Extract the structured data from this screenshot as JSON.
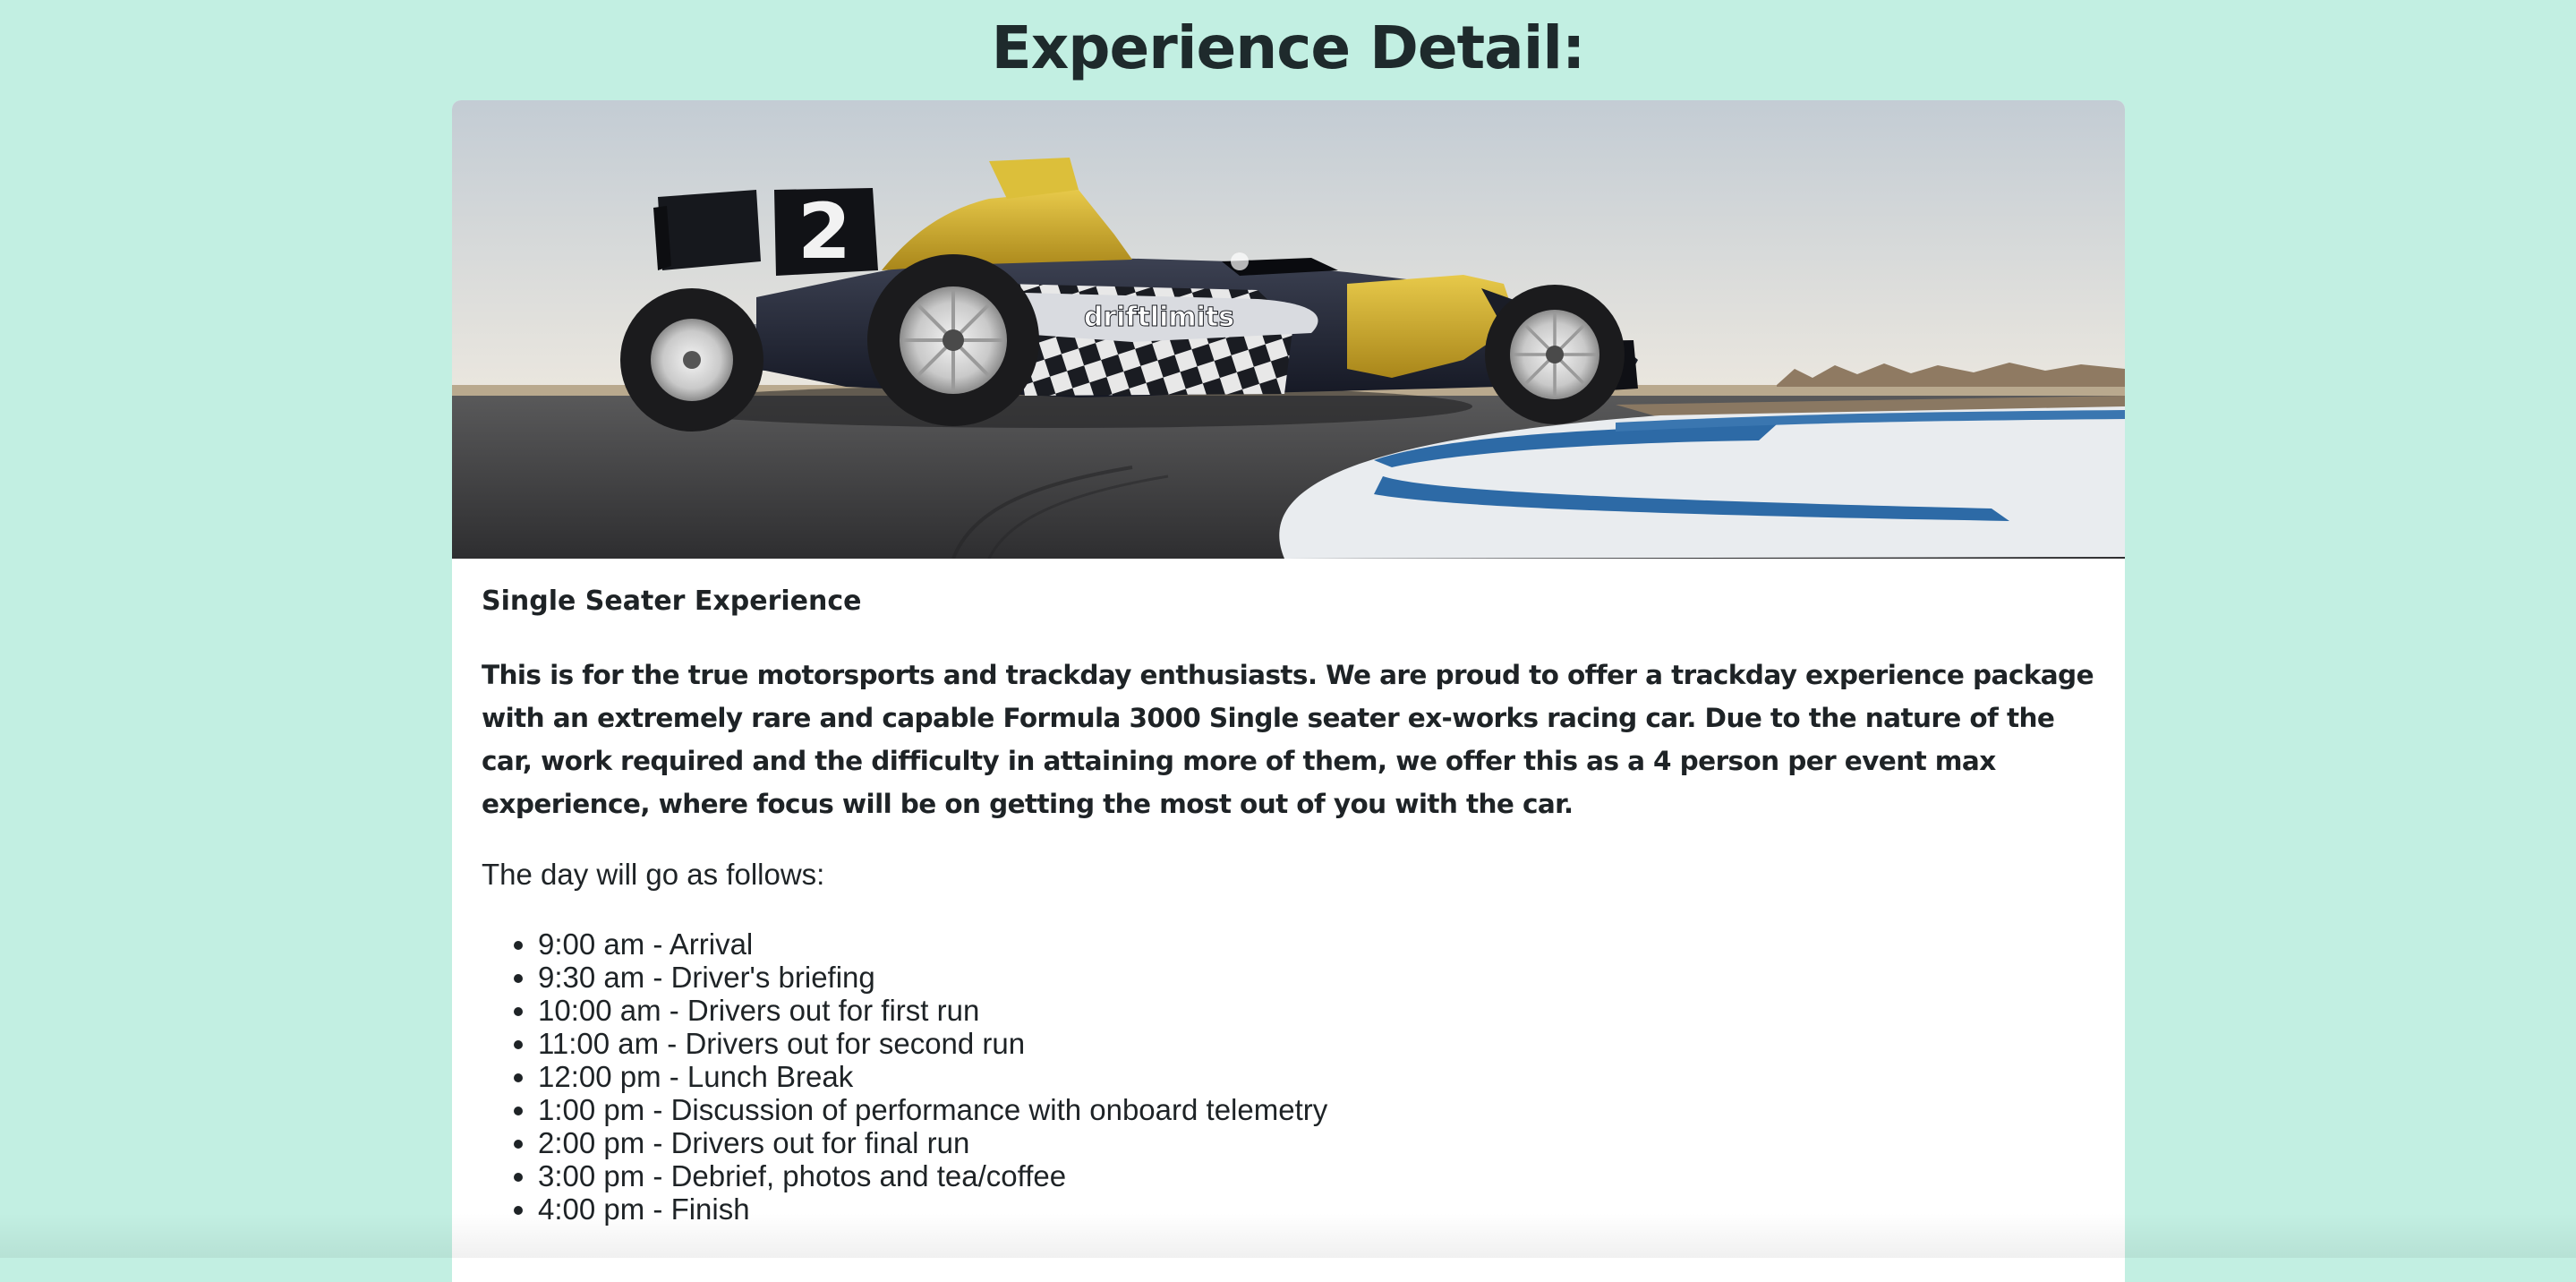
{
  "page": {
    "title": "Experience Detail:"
  },
  "experience": {
    "title": "Single Seater Experience",
    "description": "This is for the true motorsports and trackday enthusiasts. We are proud to offer a trackday experience package with an extremely rare and capable Formula 3000 Single seater ex-works racing car. Due to the nature of the car, work required and the difficulty in attaining more of them, we offer this as a 4 person per event max experience, where focus will be on getting the most out of you with the car.",
    "intro": "The day will go as follows:",
    "schedule": [
      "9:00 am - Arrival",
      "9:30 am - Driver's briefing",
      "10:00 am - Drivers out for first run",
      "11:00 am - Drivers out for second run",
      "12:00 pm - Lunch Break",
      "1:00 pm - Discussion of performance with onboard telemetry",
      "2:00 pm - Drivers out for final run",
      "3:00 pm - Debrief, photos and tea/coffee",
      "4:00 pm - Finish"
    ]
  },
  "hero_image": {
    "car_number": "2",
    "car_livery_text": "driftlimits",
    "colors": {
      "sky_top": "#c7cfd6",
      "sky_bottom": "#e6e4df",
      "asphalt": "#3a3a3c",
      "car_yellow": "#d4b22a",
      "car_dark": "#1c2030",
      "kerb_blue": "#2d6aa6",
      "kerb_white": "#eef0f2"
    }
  },
  "colors": {
    "background": "#c2efe2",
    "card": "#ffffff",
    "text": "#1e2326"
  }
}
